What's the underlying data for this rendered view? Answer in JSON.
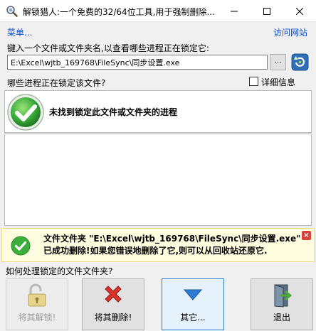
{
  "window": {
    "title": "解锁猎人:一个免费的32/64位工具,用于强制删除...",
    "app_icon": "magnifier-gear-icon"
  },
  "menu": {
    "menu_label": "菜单...",
    "visit_site_label": "访问网站"
  },
  "input": {
    "prompt": "键入一个文件或文件夹名,以查看哪些进程正在锁定它:",
    "path_value": "E:\\Excel\\wjtb_169768\\FileSync\\同步设置.exe",
    "browse_label": "..."
  },
  "processes": {
    "question": "哪些进程正在锁定该文件?",
    "details_label": "详细信息",
    "details_checked": false,
    "status_message": "未找到锁定此文件或文件夹的进程",
    "status_icon": "green-check-icon"
  },
  "notification": {
    "message": "文件文件夹 \"E:\\Excel\\wjtb_169768\\FileSync\\同步设置.exe\" 已成功删除!如果您错误地删除了它,则可以从回收站还原它.",
    "close_icon": "close-icon"
  },
  "actions": {
    "question": "如何处理锁定的文件文件夹?",
    "unlock_label": "将其解锁!",
    "delete_label": "将其删除!",
    "other_label": "其它...",
    "exit_label": "退出"
  },
  "colors": {
    "link": "#0a4bd0",
    "success_green": "#3cae3c",
    "delete_red": "#d8322b",
    "accent_blue": "#2f7bd4",
    "notify_bg": "#fffce0"
  }
}
